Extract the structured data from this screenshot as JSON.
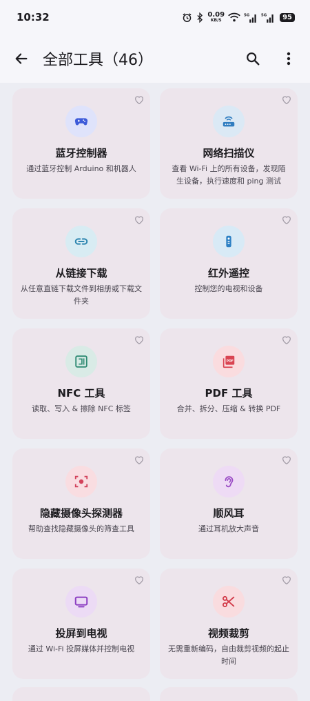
{
  "status": {
    "time": "10:32",
    "speed_value": "0.09",
    "speed_unit": "KB/S",
    "battery": "95"
  },
  "header": {
    "title": "全部工具（46）"
  },
  "tools": [
    {
      "title": "蓝牙控制器",
      "desc": "通过蓝牙控制 Arduino 和机器人",
      "icon": "gamepad-icon",
      "bg": "#dfe3fb",
      "fg": "#3d5bd9"
    },
    {
      "title": "网络扫描仪",
      "desc": "查看 Wi-Fi 上的所有设备，发现陌生设备，执行速度和 ping 测试",
      "icon": "router-icon",
      "bg": "#dbe9f5",
      "fg": "#2f7dc0"
    },
    {
      "title": "从链接下载",
      "desc": "从任意直链下载文件到相册或下载文件夹",
      "icon": "link-icon",
      "bg": "#d8ecf3",
      "fg": "#2e86b0"
    },
    {
      "title": "红外遥控",
      "desc": "控制您的电视和设备",
      "icon": "remote-icon",
      "bg": "#d8eaf6",
      "fg": "#2d80c4"
    },
    {
      "title": "NFC 工具",
      "desc": "读取、写入 & 擦除 NFC 标签",
      "icon": "nfc-icon",
      "bg": "#d9ebe6",
      "fg": "#2f8b73"
    },
    {
      "title": "PDF 工具",
      "desc": "合并、拆分、压缩 & 转换 PDF",
      "icon": "pdf-icon",
      "bg": "#fadcdf",
      "fg": "#d94452"
    },
    {
      "title": "隐藏摄像头探测器",
      "desc": "帮助查找隐藏摄像头的筛查工具",
      "icon": "camera-scan-icon",
      "bg": "#f9dde1",
      "fg": "#d2415a"
    },
    {
      "title": "顺风耳",
      "desc": "通过耳机放大声音",
      "icon": "ear-icon",
      "bg": "#eedbf5",
      "fg": "#9b4dc6"
    },
    {
      "title": "投屏到电视",
      "desc": "通过 Wi-Fi 投屏媒体并控制电视",
      "icon": "tv-icon",
      "bg": "#ecdbf5",
      "fg": "#8c3fc2"
    },
    {
      "title": "视频裁剪",
      "desc": "无需重新编码，自由裁剪视频的起止时间",
      "icon": "scissors-icon",
      "bg": "#f9dcdf",
      "fg": "#d23a49"
    }
  ]
}
